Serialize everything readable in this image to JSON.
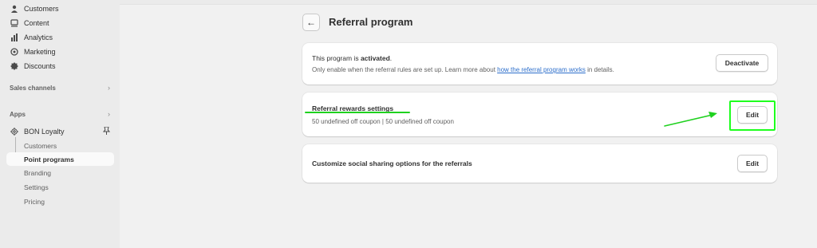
{
  "sidebar": {
    "items": [
      {
        "label": "Customers",
        "icon": "person-icon"
      },
      {
        "label": "Content",
        "icon": "content-icon"
      },
      {
        "label": "Analytics",
        "icon": "bar-chart-icon"
      },
      {
        "label": "Marketing",
        "icon": "target-icon"
      },
      {
        "label": "Discounts",
        "icon": "discount-badge-icon"
      }
    ],
    "sales_channels": "Sales channels",
    "apps": "Apps",
    "app_name": "BON Loyalty",
    "app_items": [
      "Customers",
      "Point programs",
      "Branding",
      "Settings",
      "Pricing"
    ]
  },
  "header": {
    "title": "Referral program"
  },
  "status_card": {
    "prefix": "This program is ",
    "status": "activated",
    "suffix": ".",
    "note_before": "Only enable when the referral rules are set up. Learn more about ",
    "link": "how the referral program works",
    "note_after": " in details.",
    "button": "Deactivate"
  },
  "rewards_card": {
    "title": "Referral rewards settings",
    "summary": "50 undefined off coupon | 50 undefined off coupon",
    "button": "Edit"
  },
  "social_card": {
    "title": "Customize social sharing options for the referrals",
    "button": "Edit"
  },
  "colors": {
    "highlight": "#1eff1e",
    "link": "#2c6ecb",
    "sidebar_bg": "#ebebeb"
  }
}
